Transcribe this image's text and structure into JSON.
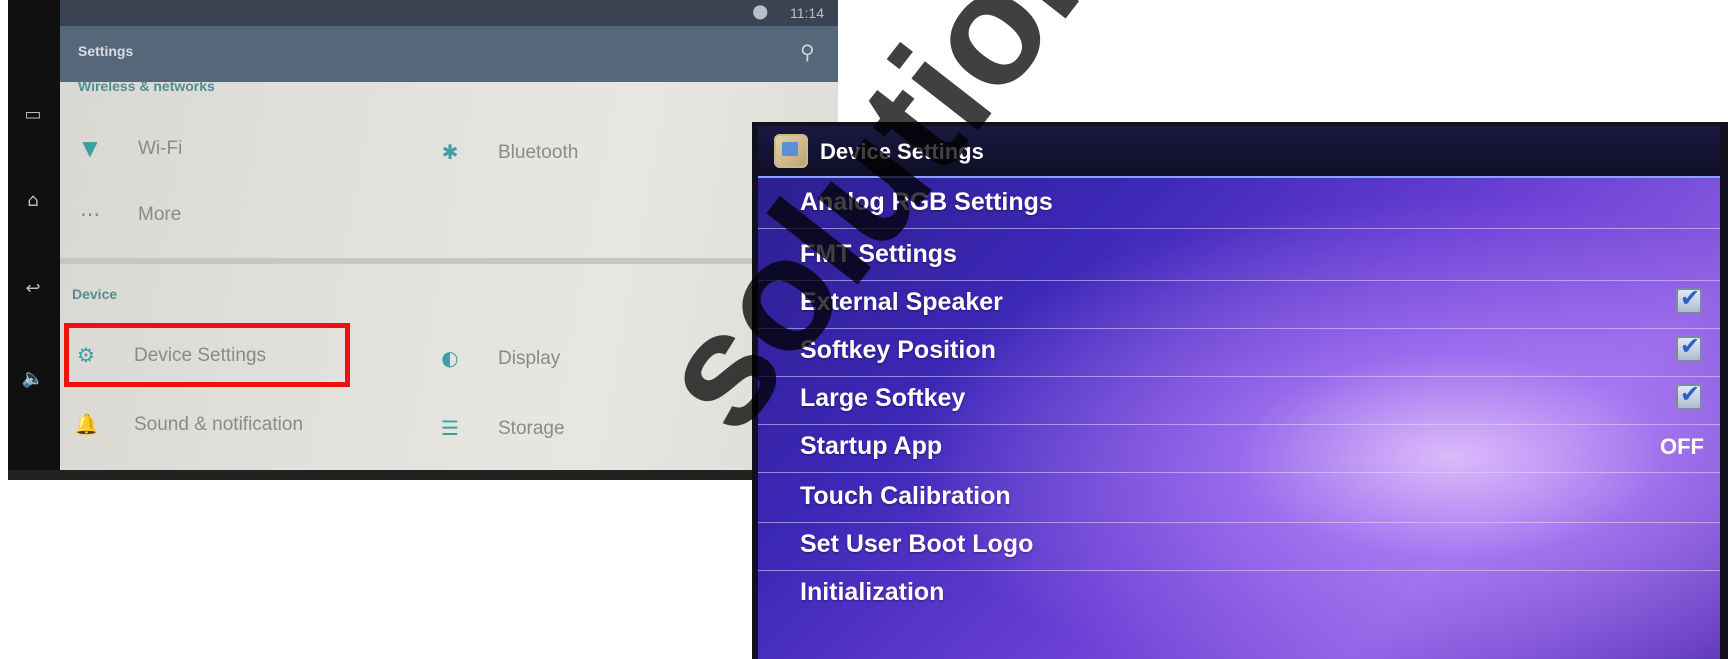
{
  "left_screen": {
    "status_bar": {
      "time": "11:14"
    },
    "app_bar": {
      "title": "Settings"
    },
    "sections": {
      "wireless": "Wireless & networks",
      "device": "Device"
    },
    "items": {
      "wifi": "Wi-Fi",
      "bluetooth": "Bluetooth",
      "more": "More",
      "device_settings": "Device Settings",
      "display": "Display",
      "sound": "Sound & notification",
      "storage": "Storage"
    },
    "highlight_color": "#f01010",
    "accent_color": "#3d9ea3"
  },
  "right_screen": {
    "title": "Device Settings",
    "menu": [
      {
        "label": "Analog RGB Settings"
      },
      {
        "label": "FMT Settings"
      },
      {
        "label": "External Speaker",
        "checked": true
      },
      {
        "label": "Softkey Position",
        "checked": true
      },
      {
        "label": "Large Softkey",
        "checked": true
      },
      {
        "label": "Startup App",
        "value": "OFF"
      },
      {
        "label": "Touch Calibration"
      },
      {
        "label": "Set User Boot Logo"
      },
      {
        "label": "Initialization"
      }
    ]
  },
  "watermark": "solutions.com"
}
